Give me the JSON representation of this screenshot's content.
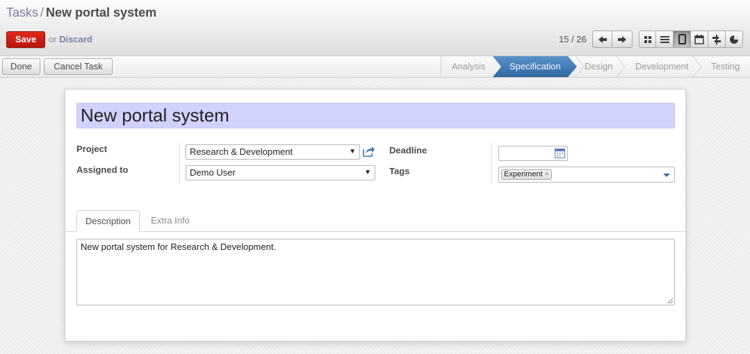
{
  "breadcrumb": {
    "parent": "Tasks",
    "separator": "/",
    "current": "New portal system"
  },
  "toolbar": {
    "save_label": "Save",
    "or_text": "or",
    "discard_label": "Discard",
    "pager": "15 / 26",
    "views": [
      "kanban-view-icon",
      "list-view-icon",
      "form-view-icon",
      "calendar-view-icon",
      "gantt-view-icon",
      "graph-view-icon"
    ],
    "active_view": "form-view-icon"
  },
  "statusbar": {
    "done_label": "Done",
    "cancel_label": "Cancel Task",
    "stages": [
      "Analysis",
      "Specification",
      "Design",
      "Development",
      "Testing"
    ],
    "active_stage": "Specification",
    "active_color": "#3d77b3"
  },
  "form": {
    "title": "New portal system",
    "project_label": "Project",
    "project_value": "Research & Development",
    "assigned_label": "Assigned to",
    "assigned_value": "Demo User",
    "deadline_label": "Deadline",
    "deadline_value": "",
    "tags_label": "Tags",
    "tags": [
      "Experiment"
    ]
  },
  "notebook": {
    "tabs": [
      "Description",
      "Extra Info"
    ],
    "active_tab": "Description",
    "description": "New portal system for Research & Development."
  },
  "colors": {
    "accent_link": "#7c7bad",
    "save_red": "#c9190f",
    "title_bg": "#d2d2ff"
  }
}
